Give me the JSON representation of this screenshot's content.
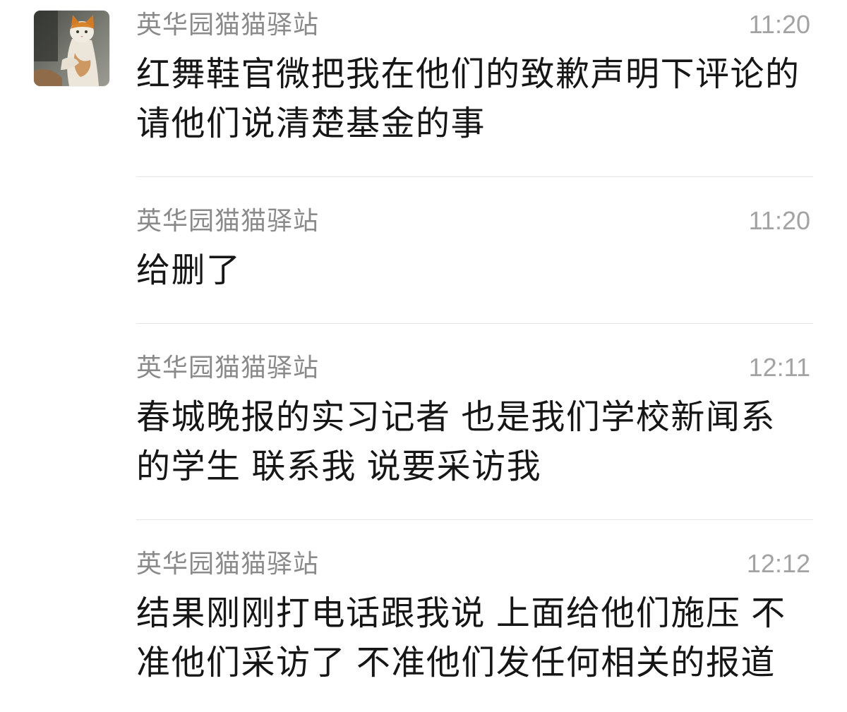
{
  "chat": {
    "messages": [
      {
        "sender": "英华园猫猫驿站",
        "time": "11:20",
        "lines": [
          "红舞鞋官微把我在他们的致歉声明下评论的",
          "请他们说清楚基金的事"
        ]
      },
      {
        "sender": "英华园猫猫驿站",
        "time": "11:20",
        "lines": [
          "给删了"
        ]
      },
      {
        "sender": "英华园猫猫驿站",
        "time": "12:11",
        "lines": [
          "春城晚报的实习记者 也是我们学校新闻系",
          "的学生 联系我 说要采访我"
        ]
      },
      {
        "sender": "英华园猫猫驿站",
        "time": "12:12",
        "lines": [
          "结果刚刚打电话跟我说 上面给他们施压 不",
          "准他们采访了 不准他们发任何相关的报道"
        ]
      }
    ]
  },
  "icons": {
    "avatar": "cat-photo"
  },
  "colors": {
    "background": "#ffffff",
    "name": "#8a8a8a",
    "time": "#a3a3a3",
    "text": "#161616",
    "divider": "#e5e5e5"
  }
}
